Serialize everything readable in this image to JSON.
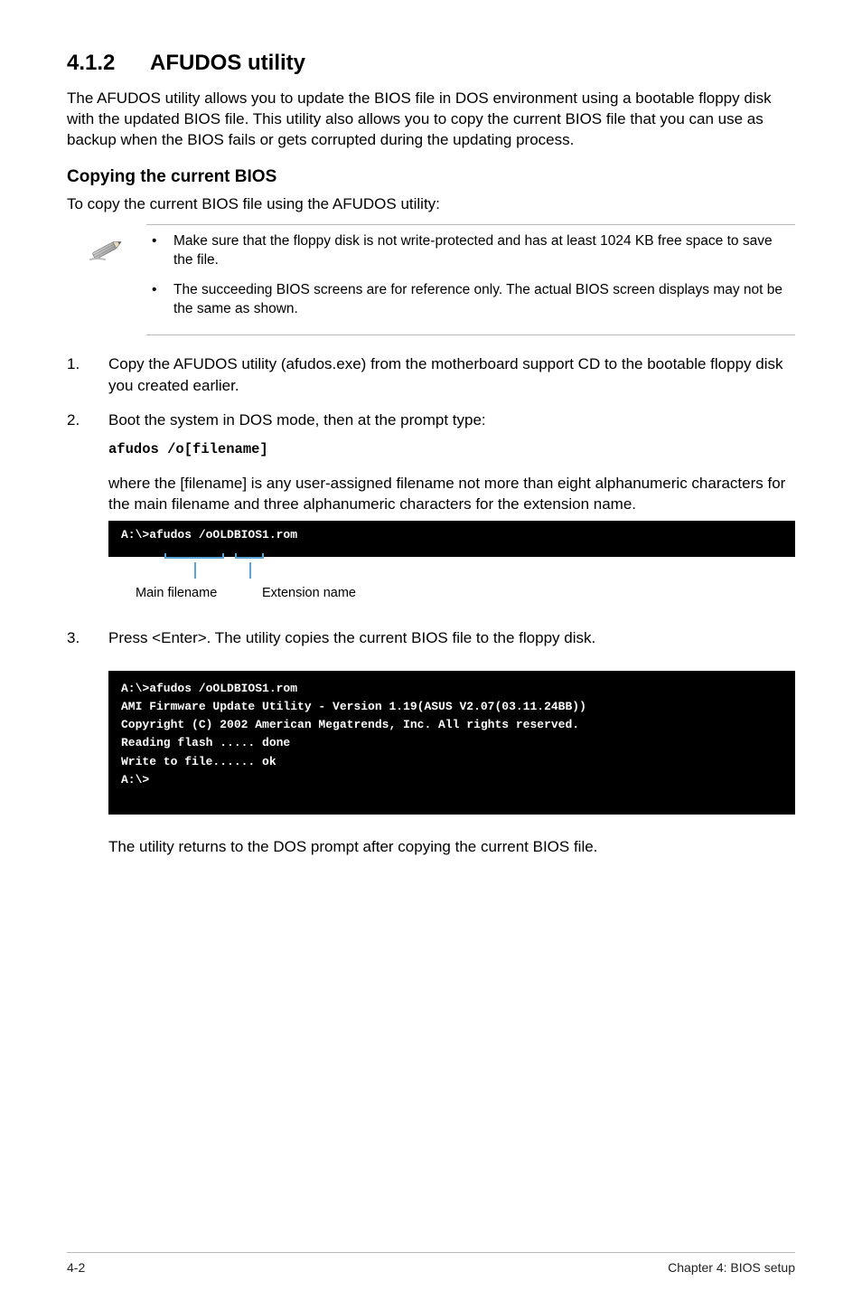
{
  "heading": {
    "number": "4.1.2",
    "title": "AFUDOS utility"
  },
  "intro": "The AFUDOS utility allows you to update the BIOS file in DOS environment using a bootable floppy disk with the updated BIOS file. This utility also allows you to copy the current BIOS file that you can use as backup when the BIOS fails or gets corrupted during the updating process.",
  "subheading": "Copying the current BIOS",
  "subintro": "To copy the current BIOS file using the AFUDOS utility:",
  "notes": [
    "Make sure that the floppy disk is not write-protected and has at least 1024 KB free space to save the file.",
    "The succeeding BIOS screens are for reference only. The actual BIOS screen displays may not be the same as shown."
  ],
  "steps": {
    "s1": "Copy the AFUDOS utility (afudos.exe) from the motherboard support CD to the bootable floppy disk you created earlier.",
    "s2": "Boot the system in DOS mode, then at the prompt type:",
    "s2_code": "afudos /o[filename]",
    "s2_after": "where the [filename] is any user-assigned filename not more than eight alphanumeric characters  for the main filename and three alphanumeric characters for the extension name.",
    "s3": "Press <Enter>. The utility copies the current BIOS file to the floppy disk.",
    "s3_after": "The utility returns to the DOS prompt after copying the current BIOS file."
  },
  "terminal1": {
    "line1": "A:\\>afudos /oOLDBIOS1.rom"
  },
  "labels": {
    "main": "Main filename",
    "ext": "Extension name"
  },
  "terminal2": {
    "l1": "A:\\>afudos /oOLDBIOS1.rom",
    "l2": "AMI Firmware Update Utility - Version 1.19(ASUS V2.07(03.11.24BB))",
    "l3": "Copyright (C) 2002 American Megatrends, Inc. All rights reserved.",
    "l4": "    Reading flash ..... done",
    "l5": "    Write to file...... ok",
    "l6": "A:\\>"
  },
  "footer": {
    "left": "4-2",
    "right": "Chapter 4: BIOS setup"
  }
}
